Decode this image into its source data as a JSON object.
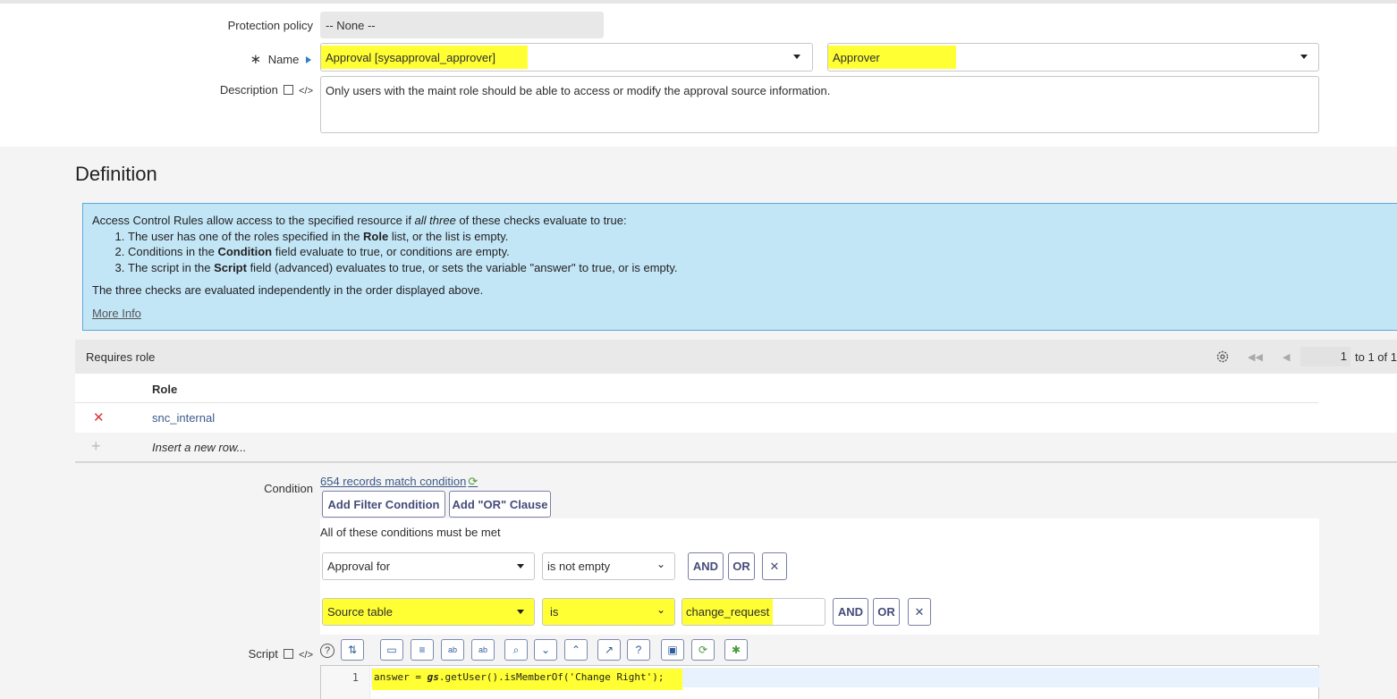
{
  "form": {
    "protection_policy_label": "Protection policy",
    "protection_policy_value": "-- None --",
    "name_required_mark": "∗",
    "name_label": "Name",
    "name_table_value": "Approval [sysapproval_approver]",
    "name_field_value": "Approver",
    "description_label": "Description",
    "description_value": "Only users with the maint role should be able to access or modify the approval source information."
  },
  "definition": {
    "title": "Definition",
    "info_intro_pre": "Access Control Rules allow access to the specified resource if ",
    "info_intro_em": "all three",
    "info_intro_post": " of these checks evaluate to true:",
    "item1_pre": "The user has one of the roles specified in the ",
    "item1_bold": "Role",
    "item1_post": " list, or the list is empty.",
    "item2_pre": "Conditions in the ",
    "item2_bold": "Condition",
    "item2_post": " field evaluate to true, or conditions are empty.",
    "item3_pre": "The script in the ",
    "item3_bold": "Script",
    "item3_post": " field (advanced) evaluates to true, or sets the variable \"answer\" to true, or is empty.",
    "info_footer": "The three checks are evaluated independently in the order displayed above.",
    "more_info": "More Info"
  },
  "roles": {
    "title": "Requires role",
    "page_value": "1",
    "page_range": "to 1 of 1",
    "column_role": "Role",
    "rows": [
      {
        "role": "snc_internal"
      }
    ],
    "insert_row": "Insert a new row..."
  },
  "condition": {
    "label": "Condition",
    "records_link": "654 records match condition",
    "add_filter": "Add Filter Condition",
    "add_or": "Add \"OR\" Clause",
    "all_met": "All of these conditions must be met",
    "row1": {
      "field": "Approval for",
      "operator": "is not empty"
    },
    "row2": {
      "field": "Source table",
      "operator": "is",
      "value": "change_request"
    },
    "and_label": "AND",
    "or_label": "OR"
  },
  "script": {
    "label": "Script",
    "line_number": "1",
    "code_pre": "answer = ",
    "code_gs": "gs",
    "code_post": ".getUser().isMemberOf('Change Right');"
  },
  "colors": {
    "highlight": "#ffff33",
    "info_bg": "#c3e6f7",
    "link": "#3c5a8a",
    "delete_red": "#d33"
  }
}
